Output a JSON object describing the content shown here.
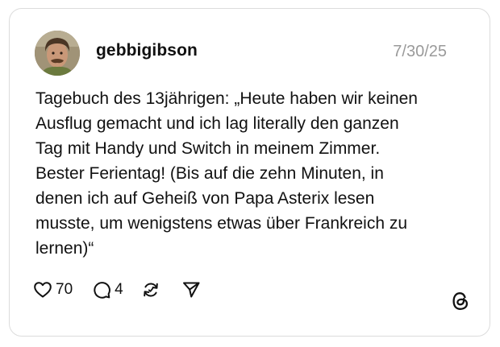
{
  "post": {
    "username": "gebbigibson",
    "date": "7/30/25",
    "text": "Tagebuch des 13jährigen: „Heute haben wir keinen\nAusflug gemacht und ich lag literally den ganzen\nTag mit Handy und Switch in meinem Zimmer.\nBester Ferientag! (Bis auf die zehn Minuten, in\ndenen ich auf Geheiß von Papa Asterix lesen\nmusste, um wenigstens etwas über Frankreich zu\nlernen)“"
  },
  "actions": {
    "like_count": "70",
    "reply_count": "4"
  },
  "icons": {
    "like": "heart-icon",
    "reply": "speech-bubble-icon",
    "repost": "repost-icon",
    "share": "send-icon",
    "brand": "threads-logo"
  },
  "colors": {
    "text": "#111111",
    "muted": "#9a9a9a",
    "border": "#dcdcdc"
  }
}
